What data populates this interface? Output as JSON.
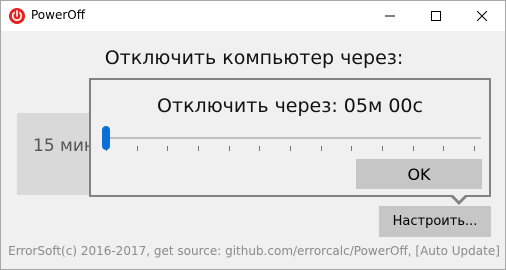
{
  "window": {
    "title": "PowerOff",
    "controls": {
      "minimize_icon": "minimize-icon",
      "maximize_icon": "maximize-icon",
      "close_icon": "close-icon"
    },
    "app_icon": "power-icon"
  },
  "main": {
    "heading": "Отключить компьютер через:",
    "preset_label": "15 мин"
  },
  "popup": {
    "title": "Отключить через: 05м 00с",
    "ok_label": "OK",
    "slider": {
      "value": 0,
      "min": 0,
      "tick_count": 13
    }
  },
  "settings_button": "Настроить...",
  "footer": "ErrorSoft(c) 2016-2017, get source: github.com/errorcalc/PowerOff, [Auto Update]",
  "colors": {
    "accent": "#0a6fd8",
    "power_icon": "#e52222",
    "button_bg": "#c6c6c6"
  }
}
